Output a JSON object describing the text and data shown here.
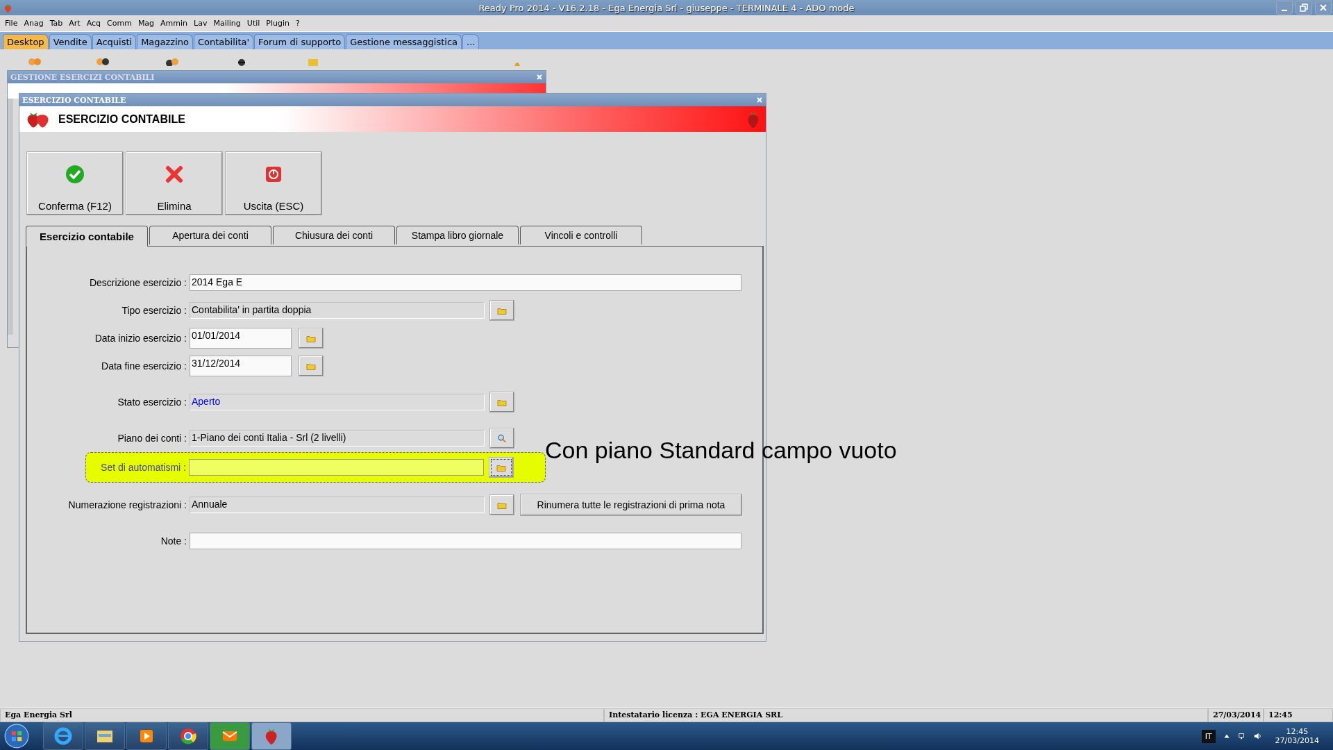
{
  "app_window": {
    "title": "Ready Pro 2014 - V16.2.18 - Ega Energia Srl - giuseppe - TERMINALE 4 - ADO mode"
  },
  "menu": [
    "File",
    "Anag",
    "Tab",
    "Art",
    "Acq",
    "Comm",
    "Mag",
    "Ammin",
    "Lav",
    "Mailing",
    "Util",
    "Plugin",
    "?"
  ],
  "module_tabs": [
    {
      "label": "Desktop",
      "selected": true
    },
    {
      "label": "Vendite",
      "selected": false
    },
    {
      "label": "Acquisti",
      "selected": false
    },
    {
      "label": "Magazzino",
      "selected": false
    },
    {
      "label": "Contabilita'",
      "selected": false
    },
    {
      "label": "Forum di supporto",
      "selected": false
    },
    {
      "label": "Gestione messaggistica",
      "selected": false
    },
    {
      "label": "...",
      "selected": false
    }
  ],
  "back_window": {
    "title": "GESTIONE ESERCIZI CONTABILI"
  },
  "dialog": {
    "title": "ESERCIZIO CONTABILE",
    "header": "ESERCIZIO CONTABILE",
    "buttons": [
      {
        "kind": "confirm",
        "label": "Conferma (F12)"
      },
      {
        "kind": "delete",
        "label": "Elimina"
      },
      {
        "kind": "exit",
        "label": "Uscita (ESC)"
      }
    ],
    "tabs": [
      {
        "label": "Esercizio contabile",
        "selected": true
      },
      {
        "label": "Apertura dei conti",
        "selected": false
      },
      {
        "label": "Chiusura dei conti",
        "selected": false
      },
      {
        "label": "Stampa libro giornale",
        "selected": false
      },
      {
        "label": "Vincoli e controlli",
        "selected": false
      }
    ],
    "groups": [
      {
        "fields": [
          {
            "label": "Descrizione esercizio :",
            "value": "2014 Ega E",
            "kind": "wide",
            "readonly": false,
            "highlighted": false,
            "accent": false
          },
          {
            "label": "Tipo esercizio :",
            "value": "Contabilita' in partita doppia",
            "kind": "picker",
            "readonly": true,
            "highlighted": false,
            "accent": false
          },
          {
            "label": "Data inizio esercizio :",
            "value": "01/01/2014",
            "kind": "date",
            "readonly": false,
            "highlighted": false,
            "accent": false
          },
          {
            "label": "Data fine esercizio :",
            "value": "31/12/2014",
            "kind": "date",
            "readonly": false,
            "highlighted": false,
            "accent": false
          }
        ]
      },
      {
        "fields": [
          {
            "label": "Stato esercizio :",
            "value": "Aperto",
            "kind": "picker",
            "readonly": true,
            "highlighted": false,
            "accent": true
          }
        ]
      },
      {
        "fields": [
          {
            "label": "Piano dei conti :",
            "value": "1-Piano dei conti Italia - Srl (2 livelli)",
            "kind": "search",
            "readonly": true,
            "highlighted": false,
            "accent": false
          },
          {
            "label": "Set di automatismi :",
            "kind": "picker",
            "readonly": true,
            "highlighted": true
          }
        ]
      },
      {
        "fields": [
          {
            "label": "Numerazione registrazioni :",
            "value": "Annuale",
            "kind": "picker",
            "readonly": true,
            "highlighted": false,
            "accent": false,
            "action": "Rinumera tutte le registrazioni di prima nota"
          }
        ]
      },
      {
        "fields": [
          {
            "label": "Note :",
            "kind": "wide",
            "readonly": false,
            "highlighted": false
          }
        ]
      }
    ]
  },
  "annotation": "Con piano Standard campo vuoto",
  "status_bar": [
    "Ega Energia Srl",
    "Intestatario licenza : EGA ENERGIA SRL",
    "27/03/2014",
    "12:45"
  ],
  "taskbar": {
    "language": "IT",
    "time": "12:45",
    "date": "27/03/2014"
  }
}
